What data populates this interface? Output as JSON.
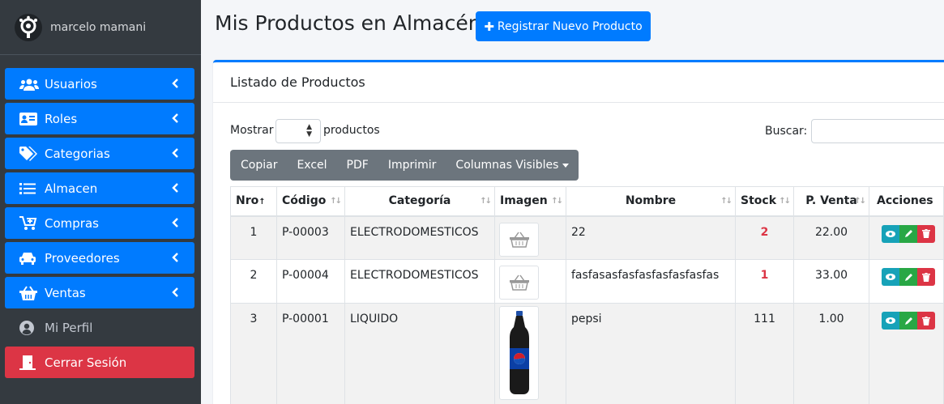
{
  "user": {
    "name": "marcelo mamani"
  },
  "sidebar": {
    "items": [
      {
        "label": "Usuarios",
        "icon": "users-icon"
      },
      {
        "label": "Roles",
        "icon": "id-card-icon"
      },
      {
        "label": "Categorias",
        "icon": "tags-icon"
      },
      {
        "label": "Almacen",
        "icon": "list-icon"
      },
      {
        "label": "Compras",
        "icon": "cart-plus-icon"
      },
      {
        "label": "Proveedores",
        "icon": "car-icon"
      },
      {
        "label": "Ventas",
        "icon": "basket-icon"
      },
      {
        "label": "Mi Perfil",
        "icon": "user-circle-icon"
      },
      {
        "label": "Cerrar Sesión",
        "icon": "door-icon"
      }
    ]
  },
  "header": {
    "title": "Mis Productos en Almacén",
    "new_button": "Registrar Nuevo Producto"
  },
  "card": {
    "title": "Listado de Productos",
    "show_label": "Mostrar",
    "show_suffix": "productos",
    "search_label": "Buscar:"
  },
  "toolbar": {
    "buttons": [
      "Copiar",
      "Excel",
      "PDF",
      "Imprimir",
      "Columnas Visibles"
    ]
  },
  "table": {
    "headers": [
      "Nro",
      "Código",
      "Categoría",
      "Imagen",
      "Nombre",
      "Stock",
      "P. Venta",
      "Acciones"
    ],
    "rows": [
      {
        "nro": "1",
        "codigo": "P-00003",
        "categoria": "ELECTRODOMESTICOS",
        "nombre": "22",
        "stock": "2",
        "precio": "22.00"
      },
      {
        "nro": "2",
        "codigo": "P-00004",
        "categoria": "ELECTRODOMESTICOS",
        "nombre": "fasfasasfasfasfasfasfasfas",
        "stock": "1",
        "precio": "33.00"
      },
      {
        "nro": "3",
        "codigo": "P-00001",
        "categoria": "LIQUIDO",
        "nombre": "pepsi",
        "stock": "111",
        "precio": "1.00"
      }
    ]
  },
  "colors": {
    "primary": "#007bff",
    "danger": "#dc3545",
    "success": "#28a745",
    "info": "#17a2b8",
    "sidebar": "#343a40"
  }
}
